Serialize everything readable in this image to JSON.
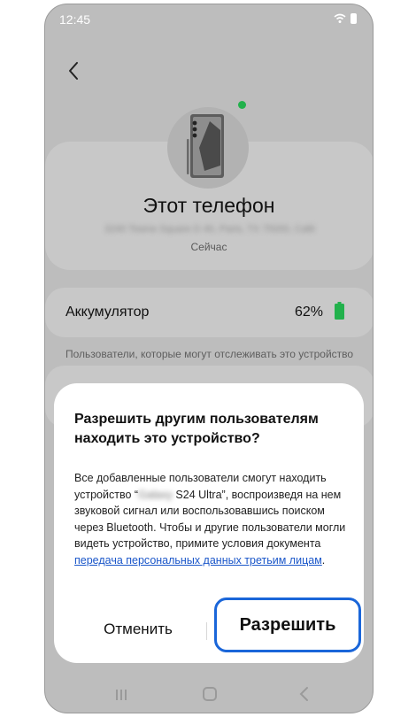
{
  "status_bar": {
    "time": "12:45",
    "wifi_icon": "wifi-icon",
    "battery_icon": "battery-icon"
  },
  "header": {
    "back_icon": "chevron-left-icon"
  },
  "device": {
    "title": "Этот телефон",
    "address": "3240 Towne Square D 40, Paris, TX 75000, Café",
    "seen": "Сейчас",
    "online_color": "#22b14c"
  },
  "battery": {
    "label": "Аккумулятор",
    "value": "62%",
    "color": "#22b14c"
  },
  "section": {
    "caption": "Пользователи, которые могут отслеживать это устройство"
  },
  "dialog": {
    "title": "Разрешить другим пользователям находить это устройство?",
    "body_part1": "Все добавленные пользователи смогут находить устройство “",
    "device_name": "Galaxy",
    "body_part2": " S24 Ultra”, воспроизведя на нем звуковой сигнал или воспользовавшись поиском через Bluetooth. Чтобы и другие пользователи могли видеть устройство, примите условия документа ",
    "link_text": "передача персональных данных третьим лицам",
    "body_end": ".",
    "cancel_label": "Отменить",
    "allow_label": "Разрешить",
    "accent_color": "#1a66d9"
  },
  "nav_bar": {
    "recent_icon": "recent-apps-icon",
    "home_icon": "home-icon",
    "back_icon": "back-icon"
  }
}
